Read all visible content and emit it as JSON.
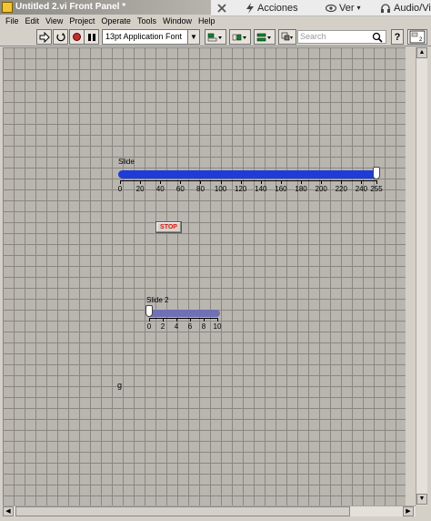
{
  "window": {
    "title": "Untitled 2.vi Front Panel *"
  },
  "overlay": {
    "items": [
      {
        "label": "Acciones",
        "icon": "bolt-icon"
      },
      {
        "label": "Ver",
        "icon": "eye-icon"
      },
      {
        "label": "Audio/Vid",
        "icon": "headphones-icon"
      }
    ]
  },
  "menubar": {
    "items": [
      "File",
      "Edit",
      "View",
      "Project",
      "Operate",
      "Tools",
      "Window",
      "Help"
    ]
  },
  "toolbar": {
    "font_select_value": "13pt Application Font",
    "search_placeholder": "Search",
    "help_label": "?"
  },
  "slide1": {
    "label": "Slide",
    "min": 0,
    "max": 255,
    "value": 255,
    "ticks": [
      "0",
      "20",
      "40",
      "60",
      "80",
      "100",
      "120",
      "140",
      "160",
      "180",
      "200",
      "220",
      "240",
      "255"
    ],
    "color": "#1e3cd8"
  },
  "stop_button": {
    "label": "STOP",
    "color": "#d81818"
  },
  "slide2": {
    "label": "Slide 2",
    "min": 0,
    "max": 10,
    "value": 0,
    "ticks": [
      "0",
      "2",
      "4",
      "6",
      "8",
      "10"
    ],
    "color": "#7070b4"
  },
  "free_label": {
    "text": "g"
  }
}
